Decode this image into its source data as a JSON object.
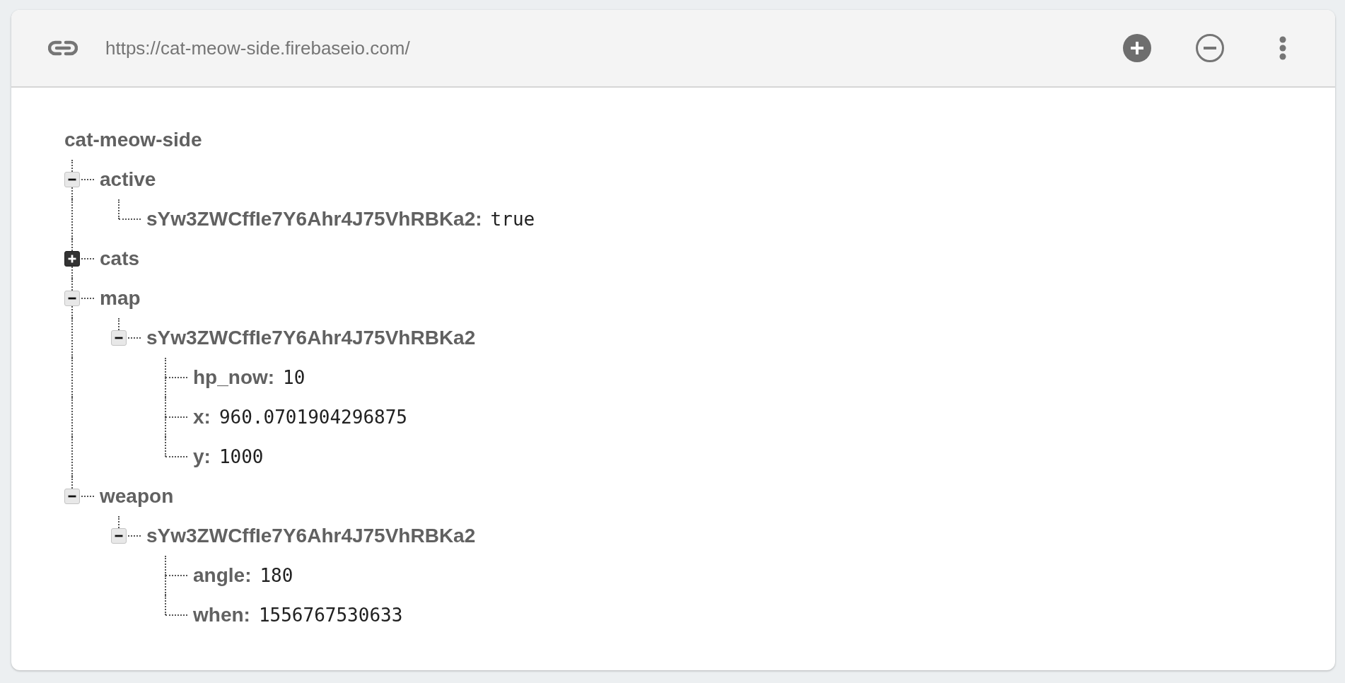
{
  "toolbar": {
    "url": "https://cat-meow-side.firebaseio.com/"
  },
  "tree": {
    "root": "cat-meow-side",
    "children": [
      {
        "key": "active",
        "expanded": true,
        "children": [
          {
            "key": "sYw3ZWCffIe7Y6Ahr4J75VhRBKa2:",
            "value": "true"
          }
        ]
      },
      {
        "key": "cats",
        "expanded": false
      },
      {
        "key": "map",
        "expanded": true,
        "children": [
          {
            "key": "sYw3ZWCffIe7Y6Ahr4J75VhRBKa2",
            "expanded": true,
            "children": [
              {
                "key": "hp_now:",
                "value": "10"
              },
              {
                "key": "x:",
                "value": "960.0701904296875"
              },
              {
                "key": "y:",
                "value": "1000"
              }
            ]
          }
        ]
      },
      {
        "key": "weapon",
        "expanded": true,
        "children": [
          {
            "key": "sYw3ZWCffIe7Y6Ahr4J75VhRBKa2",
            "expanded": true,
            "children": [
              {
                "key": "angle:",
                "value": "180"
              },
              {
                "key": "when:",
                "value": "1556767530633"
              }
            ]
          }
        ]
      }
    ]
  }
}
